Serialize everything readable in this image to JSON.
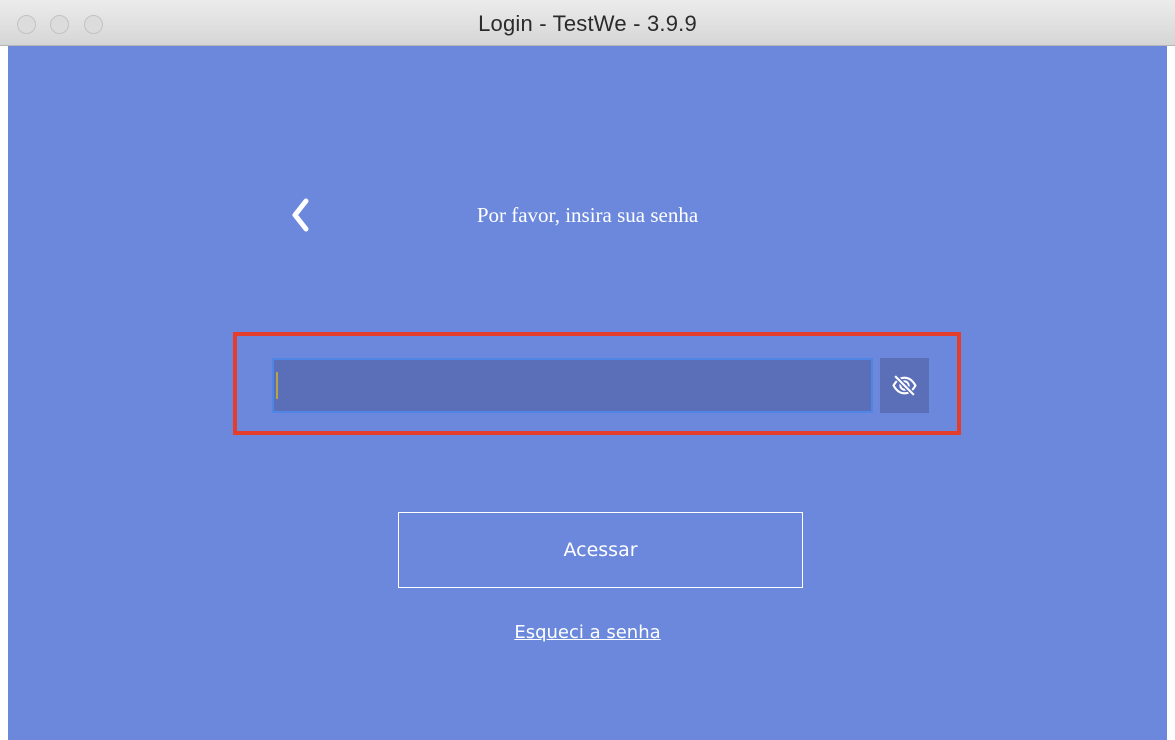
{
  "window": {
    "title": "Login - TestWe - 3.9.9"
  },
  "login": {
    "back_icon": "chevron-left-icon",
    "prompt": "Por favor, insira sua senha",
    "password_value": "",
    "toggle_icon": "eye-slash-icon",
    "submit_label": "Acessar",
    "forgot_label": "Esqueci a senha"
  },
  "colors": {
    "background": "#6b88dc",
    "input_fill": "#5a6fb7",
    "input_border": "#4f86e6",
    "highlight": "#e53d2c",
    "text": "#ffffff"
  }
}
